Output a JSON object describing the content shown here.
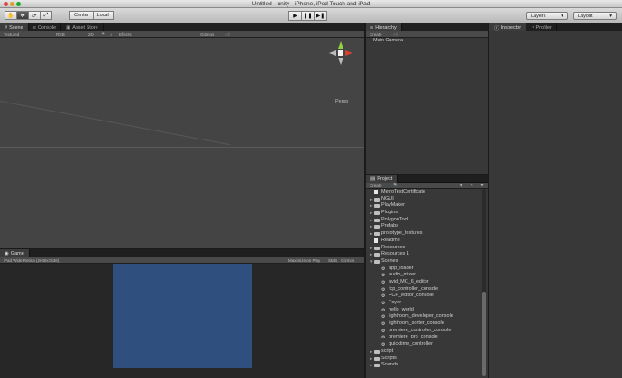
{
  "window": {
    "title": "Untitled - unity - iPhone, iPod Touch and iPad"
  },
  "toolbar": {
    "tools": [
      "✋",
      "✥",
      "⟳",
      "⤢"
    ],
    "pivot": "Center",
    "space": "Local",
    "play": "▶",
    "pause": "❚❚",
    "step": "▶❚",
    "layers": "Layers",
    "layout": "Layout",
    "caret": "▾"
  },
  "scene_panel": {
    "tabs": [
      "Scene",
      "Console",
      "Asset Store"
    ],
    "controls": {
      "shading": "Textured",
      "render": "RGB",
      "mode2d": "2D",
      "effects": "Effects",
      "gizmos": "Gizmos",
      "search": "All"
    },
    "projection": "Persp"
  },
  "game_panel": {
    "tab": "Game",
    "controls": {
      "aspect": "iPad Wide Retina (2048x1536)",
      "maximize": "Maximize on Play",
      "stats": "Stats",
      "gizmos": "Gizmos"
    }
  },
  "hierarchy": {
    "tab": "Hierarchy",
    "create": "Create",
    "search": "All",
    "items": [
      "Main Camera"
    ]
  },
  "project": {
    "tab": "Project",
    "create": "Create",
    "items": [
      {
        "label": "MetroTestCertificate",
        "kind": "file",
        "child": false
      },
      {
        "label": "NGUI",
        "kind": "folder",
        "child": false
      },
      {
        "label": "PlayMaker",
        "kind": "folder",
        "child": false
      },
      {
        "label": "Plugins",
        "kind": "folder",
        "child": false
      },
      {
        "label": "PolygonTool",
        "kind": "folder",
        "child": false
      },
      {
        "label": "Prefabs",
        "kind": "folder",
        "child": false
      },
      {
        "label": "prototype_textures",
        "kind": "folder",
        "child": false
      },
      {
        "label": "Readme",
        "kind": "file",
        "child": false
      },
      {
        "label": "Resources",
        "kind": "folder",
        "child": false
      },
      {
        "label": "Resources 1",
        "kind": "folder",
        "child": false
      },
      {
        "label": "Scenes",
        "kind": "folder-open",
        "child": false
      },
      {
        "label": "app_loader",
        "kind": "scene",
        "child": true
      },
      {
        "label": "audio_mixer",
        "kind": "scene",
        "child": true
      },
      {
        "label": "avid_MC_6_editor",
        "kind": "scene",
        "child": true
      },
      {
        "label": "fcp_controller_console",
        "kind": "scene",
        "child": true
      },
      {
        "label": "FCP_editor_console",
        "kind": "scene",
        "child": true
      },
      {
        "label": "Foyer",
        "kind": "scene",
        "child": true
      },
      {
        "label": "hello_world",
        "kind": "scene",
        "child": true
      },
      {
        "label": "lightroom_developer_console",
        "kind": "scene",
        "child": true
      },
      {
        "label": "lightroom_sorter_console",
        "kind": "scene",
        "child": true
      },
      {
        "label": "premiere_controller_console",
        "kind": "scene",
        "child": true
      },
      {
        "label": "premiere_pro_console",
        "kind": "scene",
        "child": true
      },
      {
        "label": "quicktime_controller",
        "kind": "scene",
        "child": true
      },
      {
        "label": "script",
        "kind": "folder",
        "child": false
      },
      {
        "label": "Scripts",
        "kind": "folder",
        "child": false
      },
      {
        "label": "Sounds",
        "kind": "folder",
        "child": false
      }
    ]
  },
  "inspector": {
    "tabs": [
      "Inspector",
      "Profiler"
    ]
  },
  "colors": {
    "accent": "#2f4f7f",
    "panel": "#383838",
    "scene_bg": "#444444"
  }
}
